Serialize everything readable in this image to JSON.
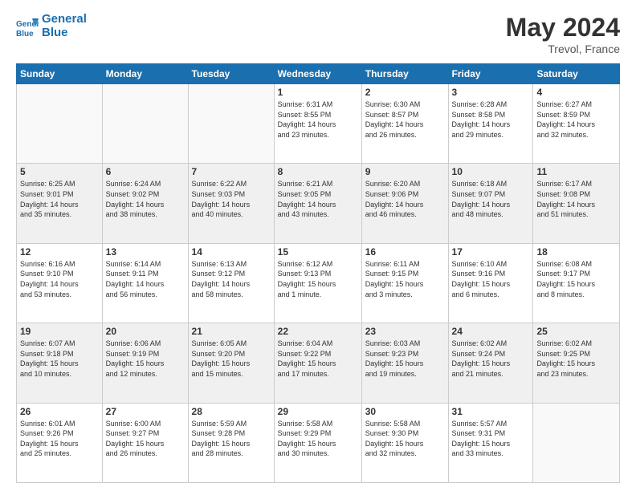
{
  "header": {
    "logo_line1": "General",
    "logo_line2": "Blue",
    "month_year": "May 2024",
    "location": "Trevol, France"
  },
  "days_of_week": [
    "Sunday",
    "Monday",
    "Tuesday",
    "Wednesday",
    "Thursday",
    "Friday",
    "Saturday"
  ],
  "weeks": [
    [
      {
        "day": "",
        "info": ""
      },
      {
        "day": "",
        "info": ""
      },
      {
        "day": "",
        "info": ""
      },
      {
        "day": "1",
        "info": "Sunrise: 6:31 AM\nSunset: 8:55 PM\nDaylight: 14 hours\nand 23 minutes."
      },
      {
        "day": "2",
        "info": "Sunrise: 6:30 AM\nSunset: 8:57 PM\nDaylight: 14 hours\nand 26 minutes."
      },
      {
        "day": "3",
        "info": "Sunrise: 6:28 AM\nSunset: 8:58 PM\nDaylight: 14 hours\nand 29 minutes."
      },
      {
        "day": "4",
        "info": "Sunrise: 6:27 AM\nSunset: 8:59 PM\nDaylight: 14 hours\nand 32 minutes."
      }
    ],
    [
      {
        "day": "5",
        "info": "Sunrise: 6:25 AM\nSunset: 9:01 PM\nDaylight: 14 hours\nand 35 minutes."
      },
      {
        "day": "6",
        "info": "Sunrise: 6:24 AM\nSunset: 9:02 PM\nDaylight: 14 hours\nand 38 minutes."
      },
      {
        "day": "7",
        "info": "Sunrise: 6:22 AM\nSunset: 9:03 PM\nDaylight: 14 hours\nand 40 minutes."
      },
      {
        "day": "8",
        "info": "Sunrise: 6:21 AM\nSunset: 9:05 PM\nDaylight: 14 hours\nand 43 minutes."
      },
      {
        "day": "9",
        "info": "Sunrise: 6:20 AM\nSunset: 9:06 PM\nDaylight: 14 hours\nand 46 minutes."
      },
      {
        "day": "10",
        "info": "Sunrise: 6:18 AM\nSunset: 9:07 PM\nDaylight: 14 hours\nand 48 minutes."
      },
      {
        "day": "11",
        "info": "Sunrise: 6:17 AM\nSunset: 9:08 PM\nDaylight: 14 hours\nand 51 minutes."
      }
    ],
    [
      {
        "day": "12",
        "info": "Sunrise: 6:16 AM\nSunset: 9:10 PM\nDaylight: 14 hours\nand 53 minutes."
      },
      {
        "day": "13",
        "info": "Sunrise: 6:14 AM\nSunset: 9:11 PM\nDaylight: 14 hours\nand 56 minutes."
      },
      {
        "day": "14",
        "info": "Sunrise: 6:13 AM\nSunset: 9:12 PM\nDaylight: 14 hours\nand 58 minutes."
      },
      {
        "day": "15",
        "info": "Sunrise: 6:12 AM\nSunset: 9:13 PM\nDaylight: 15 hours\nand 1 minute."
      },
      {
        "day": "16",
        "info": "Sunrise: 6:11 AM\nSunset: 9:15 PM\nDaylight: 15 hours\nand 3 minutes."
      },
      {
        "day": "17",
        "info": "Sunrise: 6:10 AM\nSunset: 9:16 PM\nDaylight: 15 hours\nand 6 minutes."
      },
      {
        "day": "18",
        "info": "Sunrise: 6:08 AM\nSunset: 9:17 PM\nDaylight: 15 hours\nand 8 minutes."
      }
    ],
    [
      {
        "day": "19",
        "info": "Sunrise: 6:07 AM\nSunset: 9:18 PM\nDaylight: 15 hours\nand 10 minutes."
      },
      {
        "day": "20",
        "info": "Sunrise: 6:06 AM\nSunset: 9:19 PM\nDaylight: 15 hours\nand 12 minutes."
      },
      {
        "day": "21",
        "info": "Sunrise: 6:05 AM\nSunset: 9:20 PM\nDaylight: 15 hours\nand 15 minutes."
      },
      {
        "day": "22",
        "info": "Sunrise: 6:04 AM\nSunset: 9:22 PM\nDaylight: 15 hours\nand 17 minutes."
      },
      {
        "day": "23",
        "info": "Sunrise: 6:03 AM\nSunset: 9:23 PM\nDaylight: 15 hours\nand 19 minutes."
      },
      {
        "day": "24",
        "info": "Sunrise: 6:02 AM\nSunset: 9:24 PM\nDaylight: 15 hours\nand 21 minutes."
      },
      {
        "day": "25",
        "info": "Sunrise: 6:02 AM\nSunset: 9:25 PM\nDaylight: 15 hours\nand 23 minutes."
      }
    ],
    [
      {
        "day": "26",
        "info": "Sunrise: 6:01 AM\nSunset: 9:26 PM\nDaylight: 15 hours\nand 25 minutes."
      },
      {
        "day": "27",
        "info": "Sunrise: 6:00 AM\nSunset: 9:27 PM\nDaylight: 15 hours\nand 26 minutes."
      },
      {
        "day": "28",
        "info": "Sunrise: 5:59 AM\nSunset: 9:28 PM\nDaylight: 15 hours\nand 28 minutes."
      },
      {
        "day": "29",
        "info": "Sunrise: 5:58 AM\nSunset: 9:29 PM\nDaylight: 15 hours\nand 30 minutes."
      },
      {
        "day": "30",
        "info": "Sunrise: 5:58 AM\nSunset: 9:30 PM\nDaylight: 15 hours\nand 32 minutes."
      },
      {
        "day": "31",
        "info": "Sunrise: 5:57 AM\nSunset: 9:31 PM\nDaylight: 15 hours\nand 33 minutes."
      },
      {
        "day": "",
        "info": ""
      }
    ]
  ]
}
